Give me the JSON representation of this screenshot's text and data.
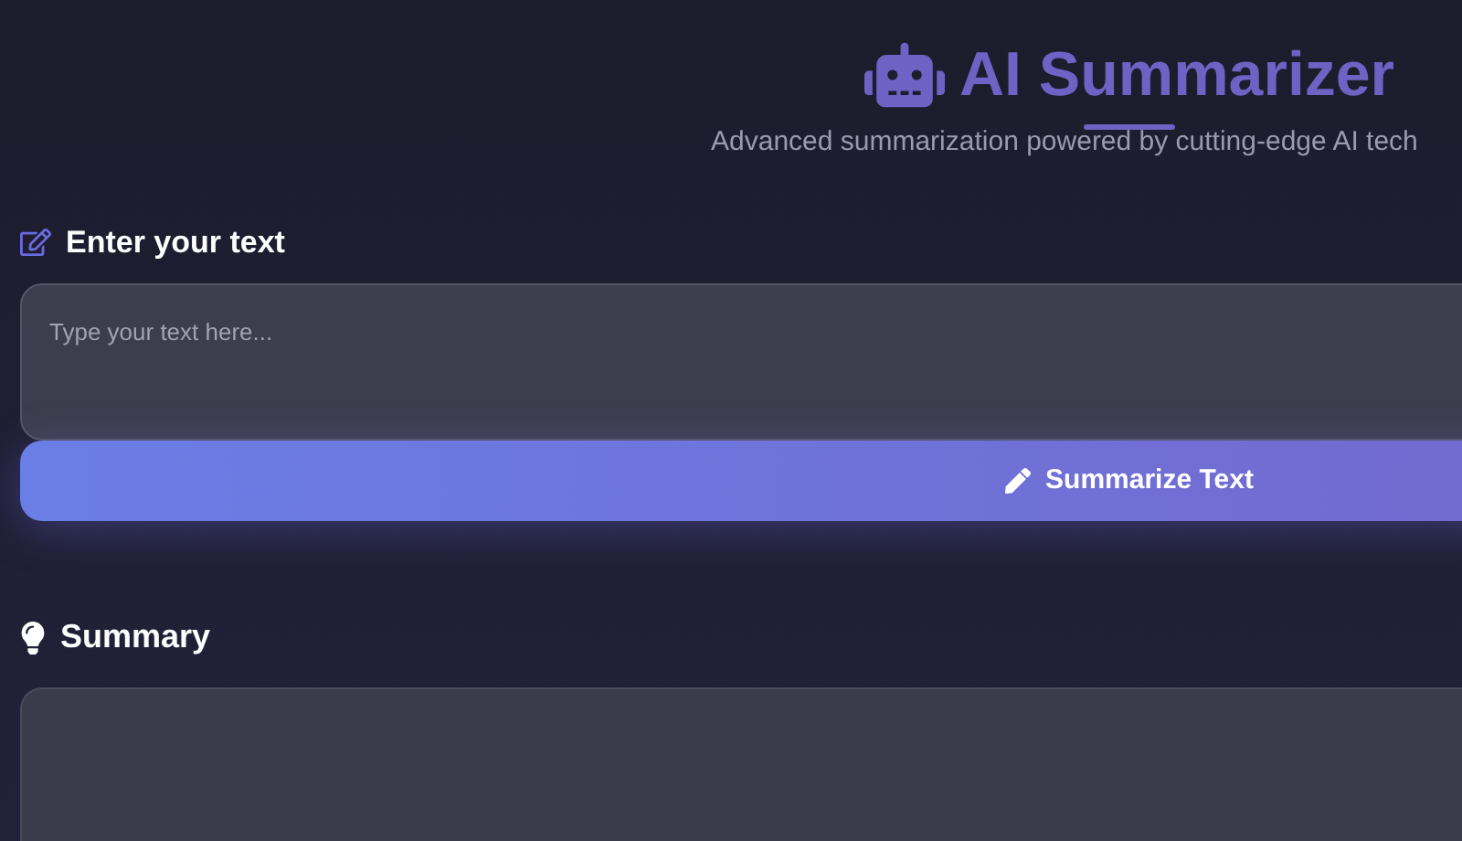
{
  "header": {
    "title": "AI Summarizer",
    "subtitle": "Advanced summarization powered by cutting-edge AI tech"
  },
  "input_section": {
    "label": "Enter your text",
    "placeholder": "Type your text here..."
  },
  "summarize_button": {
    "label": "Summarize Text"
  },
  "summary_section": {
    "label": "Summary"
  }
}
